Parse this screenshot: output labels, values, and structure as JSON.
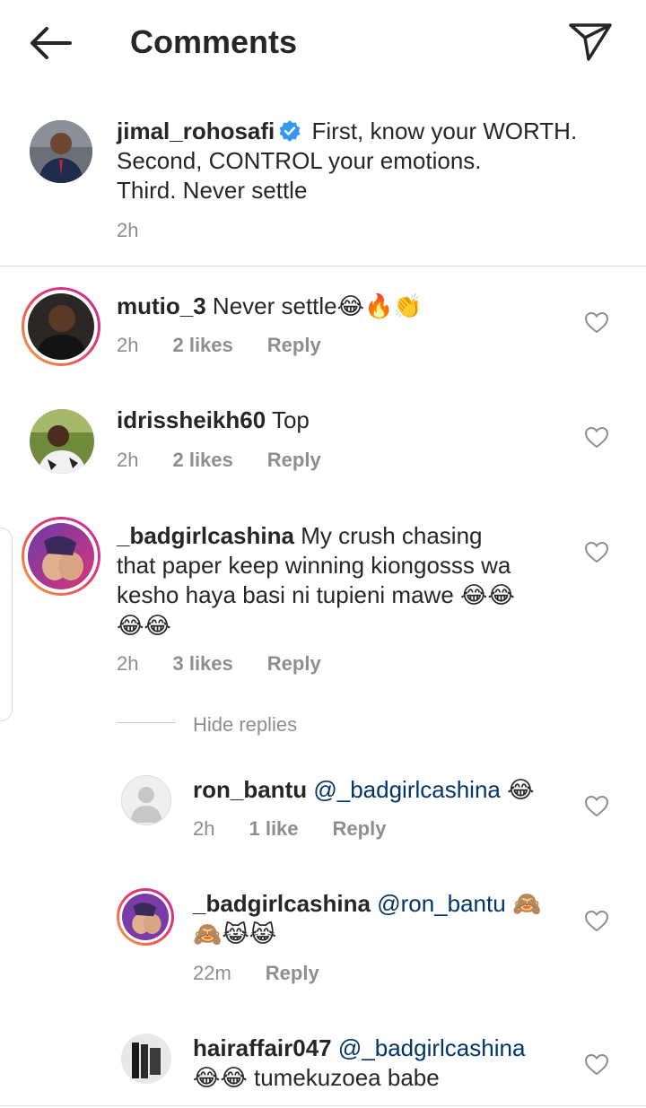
{
  "header": {
    "title": "Comments",
    "back_icon": "arrow-left-icon",
    "share_icon": "paper-plane-icon"
  },
  "caption": {
    "username": "jimal_rohosafi",
    "verified": true,
    "line1": "First, know your WORTH.",
    "line2": "Second, CONTROL your emotions.",
    "line3": "Third. Never settle",
    "time": "2h"
  },
  "comments": [
    {
      "username": "mutio_3",
      "text": "Never settle",
      "emojis": "😂🔥👏",
      "time": "2h",
      "likes": "2 likes",
      "reply": "Reply"
    },
    {
      "username": "idrissheikh60",
      "text": "Top",
      "time": "2h",
      "likes": "2 likes",
      "reply": "Reply"
    },
    {
      "username": "_badgirlcashina",
      "line1": "My crush chasing",
      "line2": "that paper keep winning kiongosss wa",
      "line3": "kesho haya basi ni tupieni mawe",
      "line3_emojis": "😂😂",
      "line4_emojis": "😂😂",
      "time": "2h",
      "likes": "3 likes",
      "reply": "Reply"
    }
  ],
  "hide_replies": "Hide replies",
  "replies": [
    {
      "username": "ron_bantu",
      "mention": "@_badgirlcashina",
      "emojis": "😂",
      "time": "2h",
      "likes": "1 like",
      "reply": "Reply"
    },
    {
      "username": "_badgirlcashina",
      "mention": "@ron_bantu",
      "emojis_line1": "🙈",
      "emojis_line2": "🙈😹😹",
      "time": "22m",
      "reply": "Reply"
    },
    {
      "username": "hairaffair047",
      "mention": "@_badgirlcashina",
      "emojis": "😂😂",
      "text": "tumekuzoea babe"
    }
  ],
  "colors": {
    "text": "#262626",
    "meta": "#8e8e8e",
    "mention": "#003569",
    "verified": "#3897f0",
    "story_ring_start": "#f7a531",
    "story_ring_end": "#c32aa3"
  }
}
